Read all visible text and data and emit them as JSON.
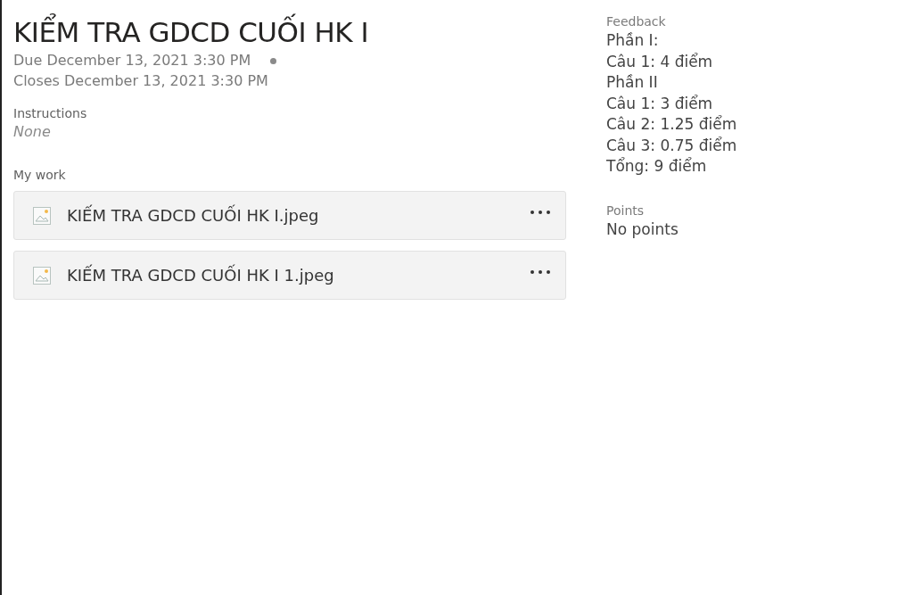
{
  "title": "KIỂM TRA GDCD CUỐI HK I",
  "due": "Due December 13, 2021 3:30 PM",
  "closes": "Closes December 13, 2021 3:30 PM",
  "instructions": {
    "label": "Instructions",
    "value": "None"
  },
  "my_work": {
    "label": "My work",
    "files": [
      {
        "name": "KIẾM TRA GDCD CUỐI HK I.jpeg"
      },
      {
        "name": "KIẾM TRA GDCD CUỐI HK I 1.jpeg"
      }
    ]
  },
  "feedback": {
    "label": "Feedback",
    "lines": [
      "Phần I:",
      "Câu 1: 4 điểm",
      "Phần II",
      "Câu 1: 3 điểm",
      "Câu 2: 1.25 điểm",
      "Câu 3: 0.75 điểm",
      "Tổng: 9 điểm"
    ]
  },
  "points": {
    "label": "Points",
    "value": "No points"
  }
}
